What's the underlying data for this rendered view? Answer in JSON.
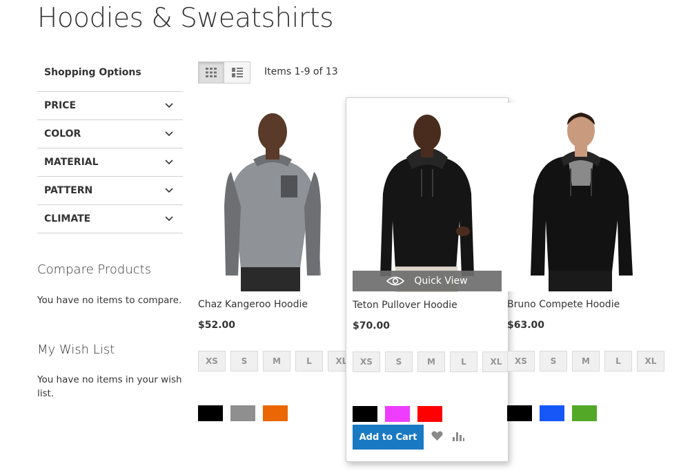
{
  "page": {
    "title": "Hoodies & Sweatshirts"
  },
  "sidebar": {
    "title": "Shopping Options",
    "filters": [
      "PRICE",
      "COLOR",
      "MATERIAL",
      "PATTERN",
      "CLIMATE"
    ]
  },
  "compare": {
    "title": "Compare Products",
    "text": "You have no items to compare."
  },
  "wishlist": {
    "title": "My Wish List",
    "text": "You have no items in your wish list."
  },
  "toolbar": {
    "items_count": "Items 1-9 of 13",
    "modes": [
      "grid-icon",
      "list-icon"
    ]
  },
  "products": [
    {
      "name": "Chaz Kangeroo Hoodie",
      "price": "$52.00",
      "sizes": [
        "XS",
        "S",
        "M",
        "L",
        "XL"
      ],
      "colors": [
        "#000000",
        "#8f8f8f",
        "#eb6703"
      ]
    },
    {
      "name": "Teton Pullover Hoodie",
      "price": "$70.00",
      "sizes": [
        "XS",
        "S",
        "M",
        "L",
        "XL"
      ],
      "colors": [
        "#000000",
        "#ef3dff",
        "#ff0000"
      ],
      "quick_view": "Quick View",
      "add_to_cart": "Add to Cart"
    },
    {
      "name": "Bruno Compete Hoodie",
      "price": "$63.00",
      "sizes": [
        "XS",
        "S",
        "M",
        "L",
        "XL"
      ],
      "colors": [
        "#000000",
        "#1857f7",
        "#53a828"
      ]
    }
  ]
}
